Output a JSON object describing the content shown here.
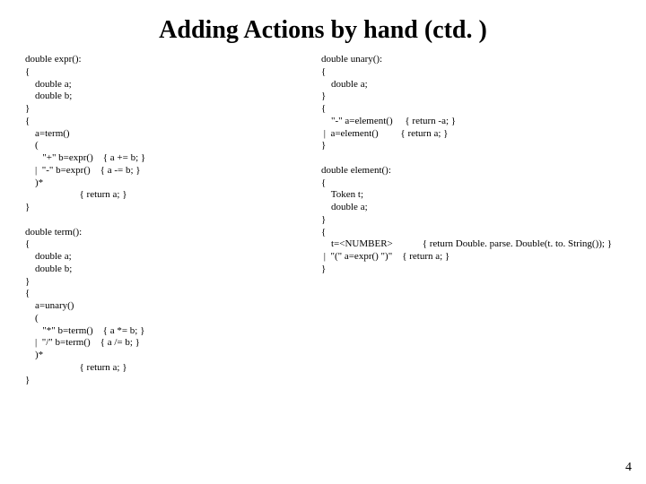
{
  "title": "Adding Actions by hand (ctd. )",
  "page_number": "4",
  "left_code": "double expr():\n{\n    double a;\n    double b;\n}\n{\n    a=term()\n    (\n       \"+\" b=expr()    { a += b; }\n    |  \"-\" b=expr()    { a -= b; }\n    )*\n                      { return a; }\n}\n\ndouble term():\n{\n    double a;\n    double b;\n}\n{\n    a=unary()\n    (\n       \"*\" b=term()    { a *= b; }\n    |  \"/\" b=term()    { a /= b; }\n    )*\n                      { return a; }\n}",
  "right_code": "double unary():\n{\n    double a;\n}\n{\n    \"-\" a=element()     { return -a; }\n |  a=element()         { return a; }\n}\n\ndouble element():\n{\n    Token t;\n    double a;\n}\n{\n    t=<NUMBER>            { return Double. parse. Double(t. to. String()); }\n |  \"(\" a=expr() \")\"    { return a; }\n}"
}
